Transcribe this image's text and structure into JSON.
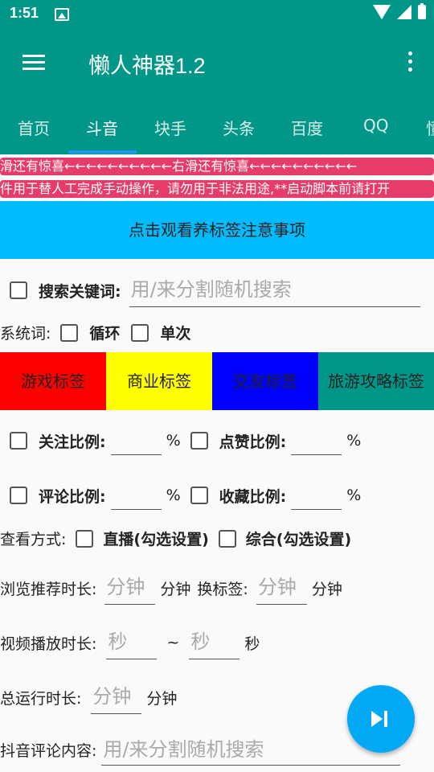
{
  "status": {
    "time": "1:51"
  },
  "appbar": {
    "title": "懒人神器1.2"
  },
  "tabs": [
    "首页",
    "斗音",
    "块手",
    "头条",
    "百度",
    "QQ",
    "懂"
  ],
  "marquee1": "滑还有惊喜←←←←←←←←←←右滑还有惊喜←←←←←←←←←←",
  "marquee2": "件用于替人工完成手动操作，请勿用于非法用途,**启动脚本前请打开",
  "banner": "点击观看养标签注意事项",
  "search": {
    "label": "搜索关键词:",
    "placeholder": "用/来分割随机搜索"
  },
  "system": {
    "label": "系统词:",
    "loop": "循环",
    "once": "单次"
  },
  "tag_buttons": [
    {
      "label": "游戏标签",
      "bg": "#ff0000"
    },
    {
      "label": "商业标签",
      "bg": "#ffff00"
    },
    {
      "label": "交友标签",
      "bg": "#0000ff"
    },
    {
      "label": "旅游攻略标签",
      "bg": "#009688"
    }
  ],
  "ratios": {
    "follow": "关注比例:",
    "like": "点赞比例:",
    "comment": "评论比例:",
    "collect": "收藏比例:",
    "pct": "%"
  },
  "view_mode": {
    "label": "查看方式:",
    "live": "直播(勾选设置)",
    "mixed": "综合(勾选设置)"
  },
  "browse": {
    "label": "浏览推荐时长:",
    "placeholder": "分钟",
    "unit": "分钟",
    "switch_label": "换标签:",
    "switch_placeholder": "分钟",
    "switch_unit": "分钟"
  },
  "video": {
    "label": "视频播放时长:",
    "min_placeholder": "秒",
    "sep": "~",
    "max_placeholder": "秒",
    "unit": "秒"
  },
  "total": {
    "label": "总运行时长:",
    "placeholder": "分钟",
    "unit": "分钟"
  },
  "comment_content": {
    "label": "抖音评论内容:",
    "placeholder": "用/来分割随机搜索"
  }
}
